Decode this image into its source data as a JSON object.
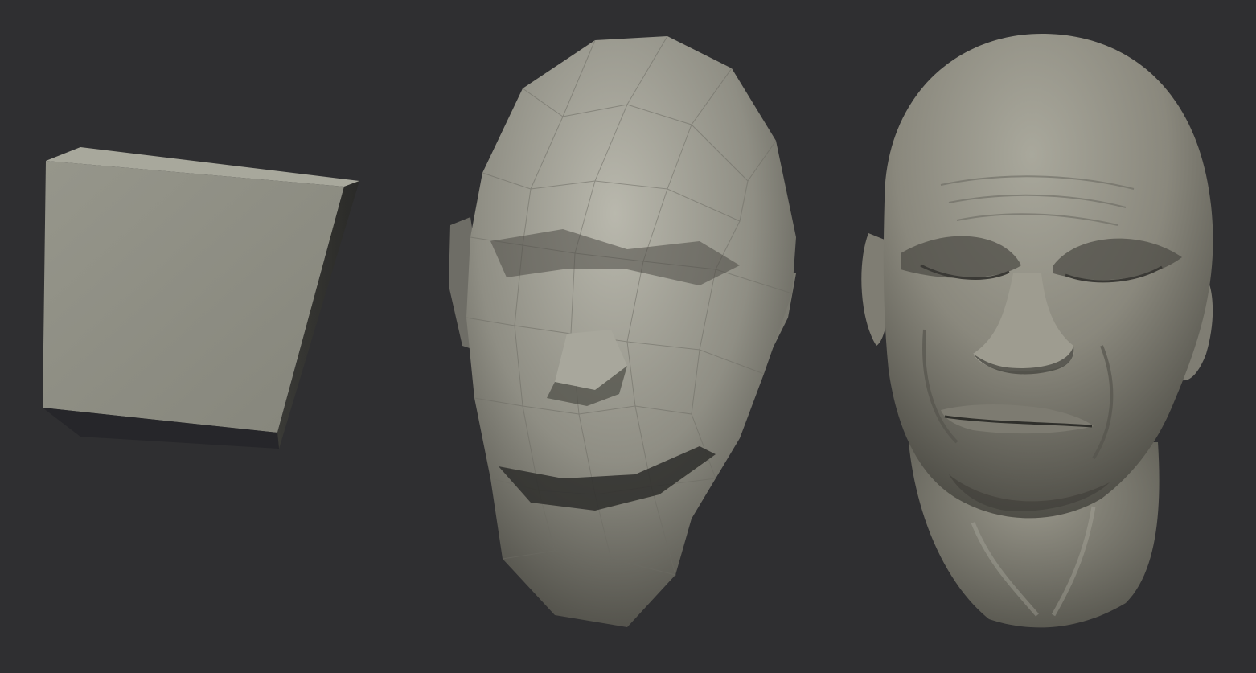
{
  "scene": {
    "background_color": "#2f2f31",
    "models": [
      {
        "id": "cube",
        "description_name": "cube-primitive",
        "material_color": "#8c8c82"
      },
      {
        "id": "lowpoly-head",
        "description_name": "lowpoly-head-mesh",
        "material_color": "#9a998e"
      },
      {
        "id": "sculpted-head",
        "description_name": "sculpted-head-mesh",
        "material_color": "#8a887d"
      }
    ]
  }
}
